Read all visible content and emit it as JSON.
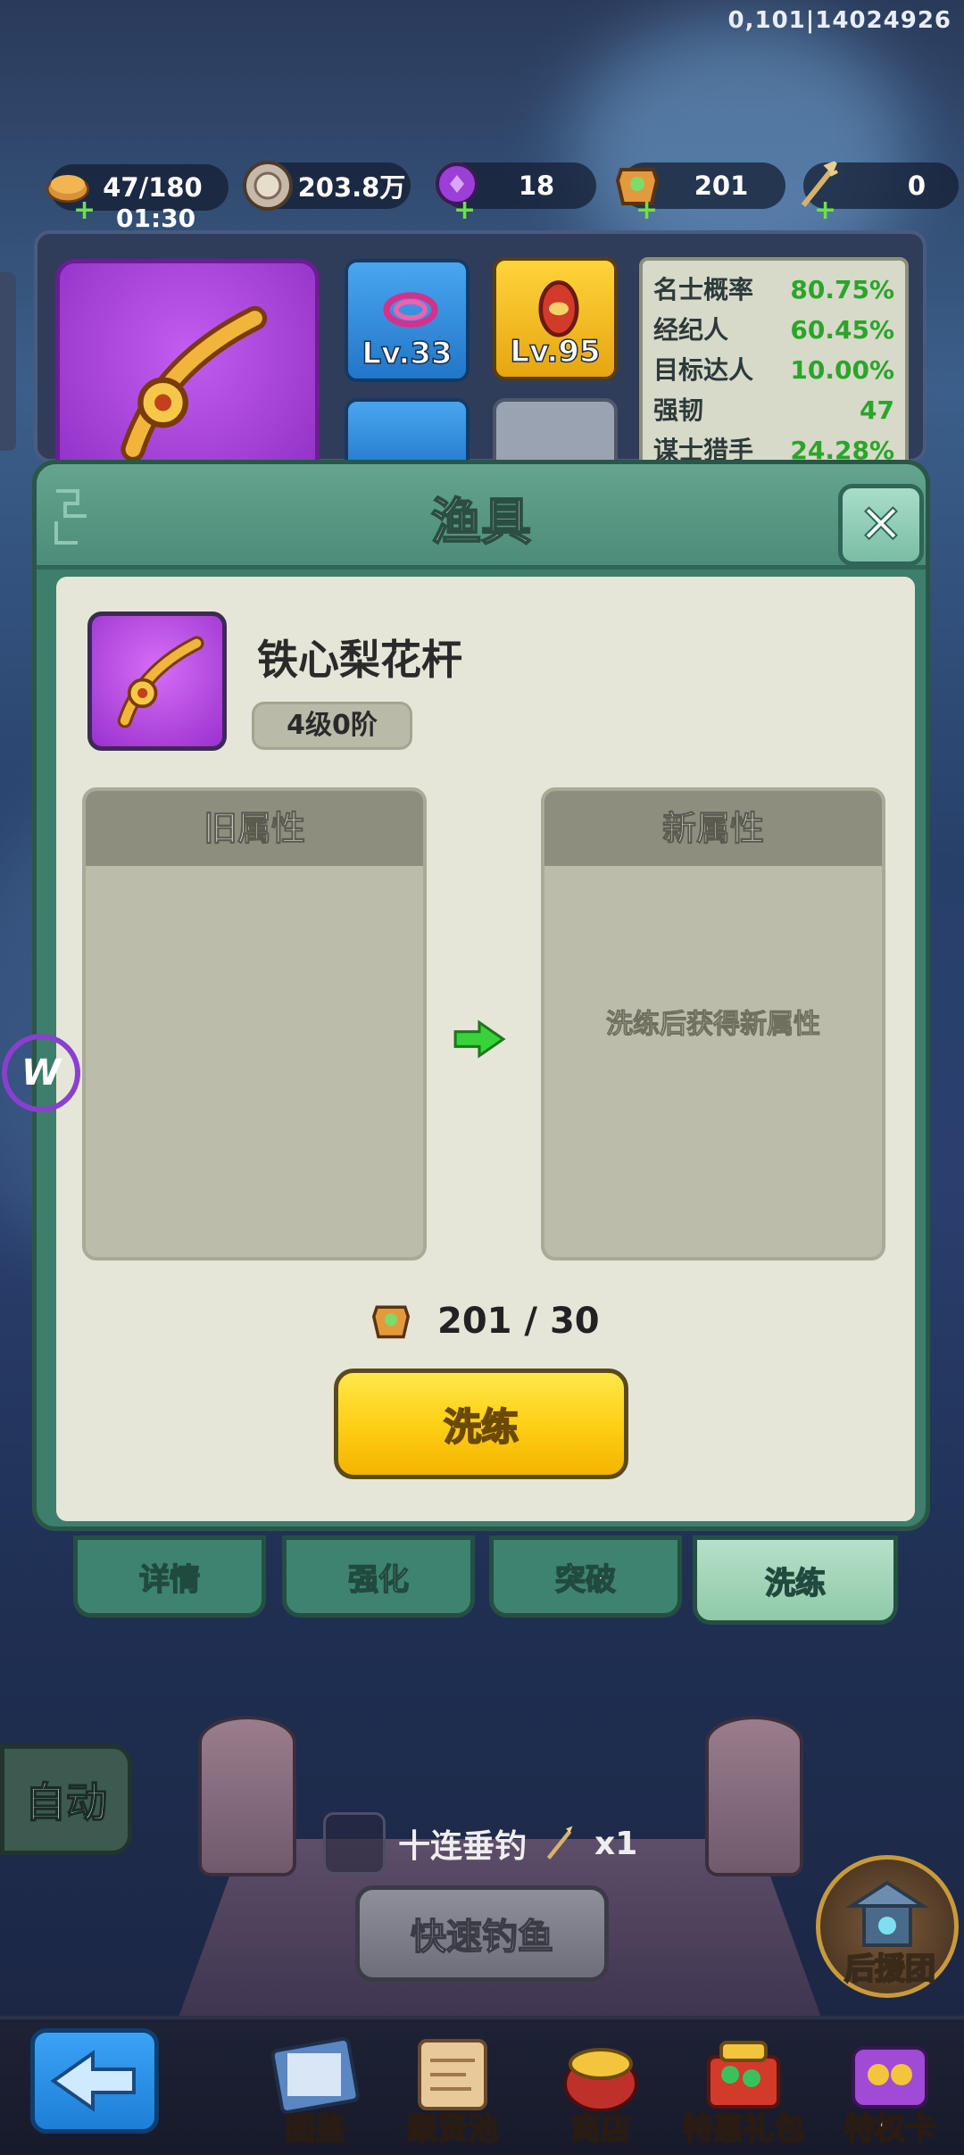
{
  "status": {
    "id_text": "0,101|14024926"
  },
  "currencies": [
    {
      "name": "bread",
      "value": "47/180",
      "timer": "01:30",
      "has_plus": true
    },
    {
      "name": "coin",
      "value": "203.8万",
      "has_plus": false
    },
    {
      "name": "purple-gem",
      "value": "18",
      "has_plus": true
    },
    {
      "name": "refine-stone",
      "value": "201",
      "has_plus": true
    },
    {
      "name": "trident",
      "value": "0",
      "has_plus": true
    }
  ],
  "gear_slots": [
    {
      "name": "rope",
      "level": "Lv.33"
    },
    {
      "name": "bait",
      "level": "Lv.95"
    }
  ],
  "stats": [
    {
      "name": "名士概率",
      "value": "80.75%"
    },
    {
      "name": "经纪人",
      "value": "60.45%"
    },
    {
      "name": "目标达人",
      "value": "10.00%"
    },
    {
      "name": "强韧",
      "value": "47"
    },
    {
      "name": "谋士猎手",
      "value": "24.28%"
    }
  ],
  "dialog": {
    "title": "渔具",
    "item": {
      "name": "铁心梨花杆",
      "level": "4级0阶"
    },
    "old_attr": {
      "header": "旧属性"
    },
    "new_attr": {
      "header": "新属性",
      "hint": "洗练后获得新属性"
    },
    "cost": "201 / 30",
    "action_label": "洗练",
    "tabs": [
      {
        "label": "详情",
        "active": false
      },
      {
        "label": "强化",
        "active": false
      },
      {
        "label": "突破",
        "active": false
      },
      {
        "label": "洗练",
        "active": true
      }
    ]
  },
  "scene": {
    "auto_label": "自动",
    "ten_cast_label": "十连垂钓",
    "ten_cast_count": "x1",
    "quick_fish_label": "快速钓鱼",
    "backup_label": "后援团"
  },
  "nav": [
    {
      "label": "图鉴",
      "icon": "book-icon"
    },
    {
      "label": "聚贤池",
      "icon": "scroll-map-icon"
    },
    {
      "label": "商店",
      "icon": "gold-pot-icon"
    },
    {
      "label": "特惠礼包",
      "icon": "gift-pack-icon"
    },
    {
      "label": "特权卡",
      "icon": "privilege-card-icon"
    }
  ],
  "colors": {
    "stat_value": "#2aa52a",
    "dialog_frame": "#3d7e6d",
    "action_button": "#fdd016"
  }
}
